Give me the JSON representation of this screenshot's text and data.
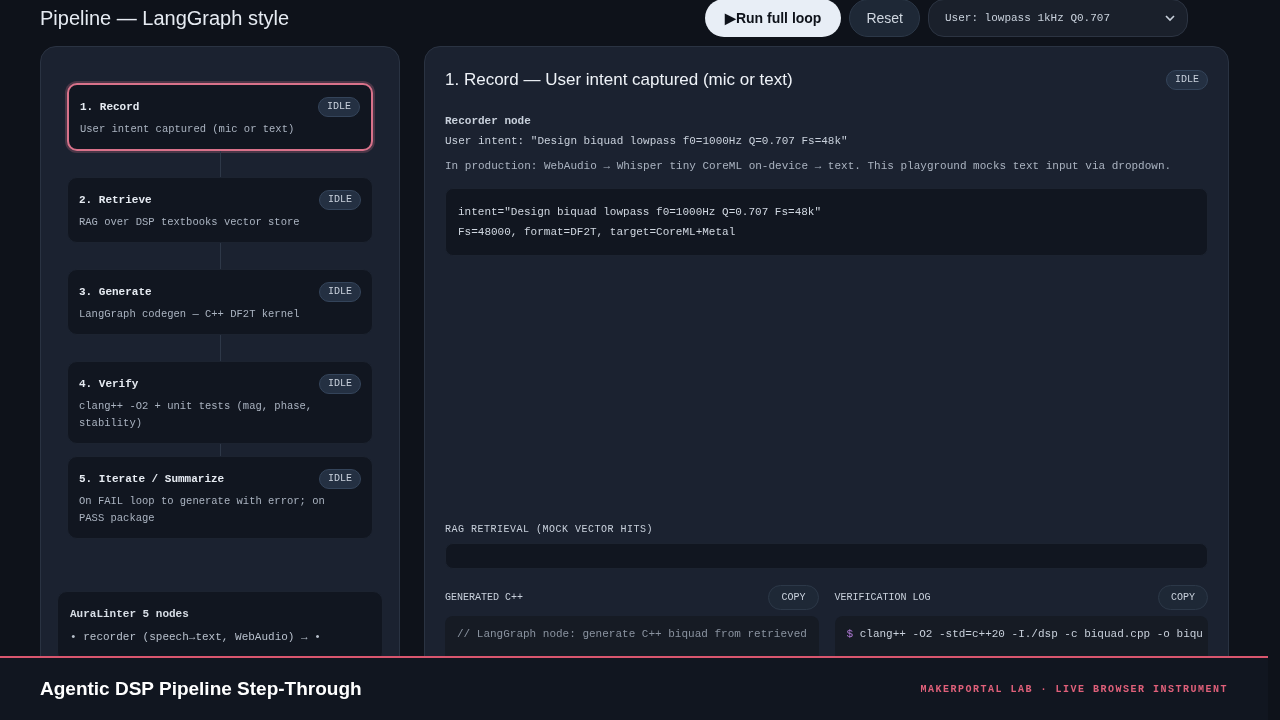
{
  "header": {
    "title": "Pipeline — LangGraph style",
    "run_button": {
      "icon": "▶",
      "label": "Run full loop"
    },
    "reset_button": "Reset",
    "scenario_select": {
      "value": "User: lowpass 1kHz Q0.707"
    }
  },
  "pipeline": {
    "nodes": [
      {
        "title": "1. Record",
        "description": "User intent captured (mic or text)",
        "status": "IDLE",
        "selected": true
      },
      {
        "title": "2. Retrieve",
        "description": "RAG over DSP textbooks vector store",
        "status": "IDLE",
        "selected": false
      },
      {
        "title": "3. Generate",
        "description": "LangGraph codegen — C++ DF2T kernel",
        "status": "IDLE",
        "selected": false
      },
      {
        "title": "4. Verify",
        "description": "clang++ -O2 + unit tests (mag, phase, stability)",
        "status": "IDLE",
        "selected": false
      },
      {
        "title": "5. Iterate / Summarize",
        "description": "On FAIL loop to generate with error; on PASS package",
        "status": "IDLE",
        "selected": false
      }
    ],
    "info": {
      "title": "AuraLinter 5 nodes",
      "lines": [
        "• recorder (speech→text, WebAudio) → •"
      ]
    }
  },
  "detail": {
    "title": "1. Record — User intent captured (mic or text)",
    "status": "IDLE",
    "subtitle": "Recorder node",
    "intent": "User intent: \"Design biquad lowpass f0=1000Hz Q=0.707 Fs=48k\"",
    "note": "In production: WebAudio → Whisper tiny CoreML on-device → text. This playground mocks text input via dropdown.",
    "code": [
      "intent=\"Design biquad lowpass f0=1000Hz Q=0.707 Fs=48k\"",
      "Fs=48000, format=DF2T, target=CoreML+Metal"
    ],
    "rag": {
      "label": "RAG RETRIEVAL (MOCK VECTOR HITS)"
    },
    "generated": {
      "label": "GENERATED C++",
      "copy": "COPY",
      "lines": [
        "// LangGraph node: generate C++ biquad from retrieved"
      ]
    },
    "verification": {
      "label": "VERIFICATION LOG",
      "copy": "COPY",
      "lines": [
        {
          "prompt": "$",
          "text": "clang++ -O2 -std=c++20 -I./dsp -c biquad.cpp -o biqu"
        }
      ]
    }
  },
  "footer": {
    "title": "Agentic DSP Pipeline Step-Through",
    "tagline": "MAKERPORTAL LAB · LIVE BROWSER INSTRUMENT"
  }
}
